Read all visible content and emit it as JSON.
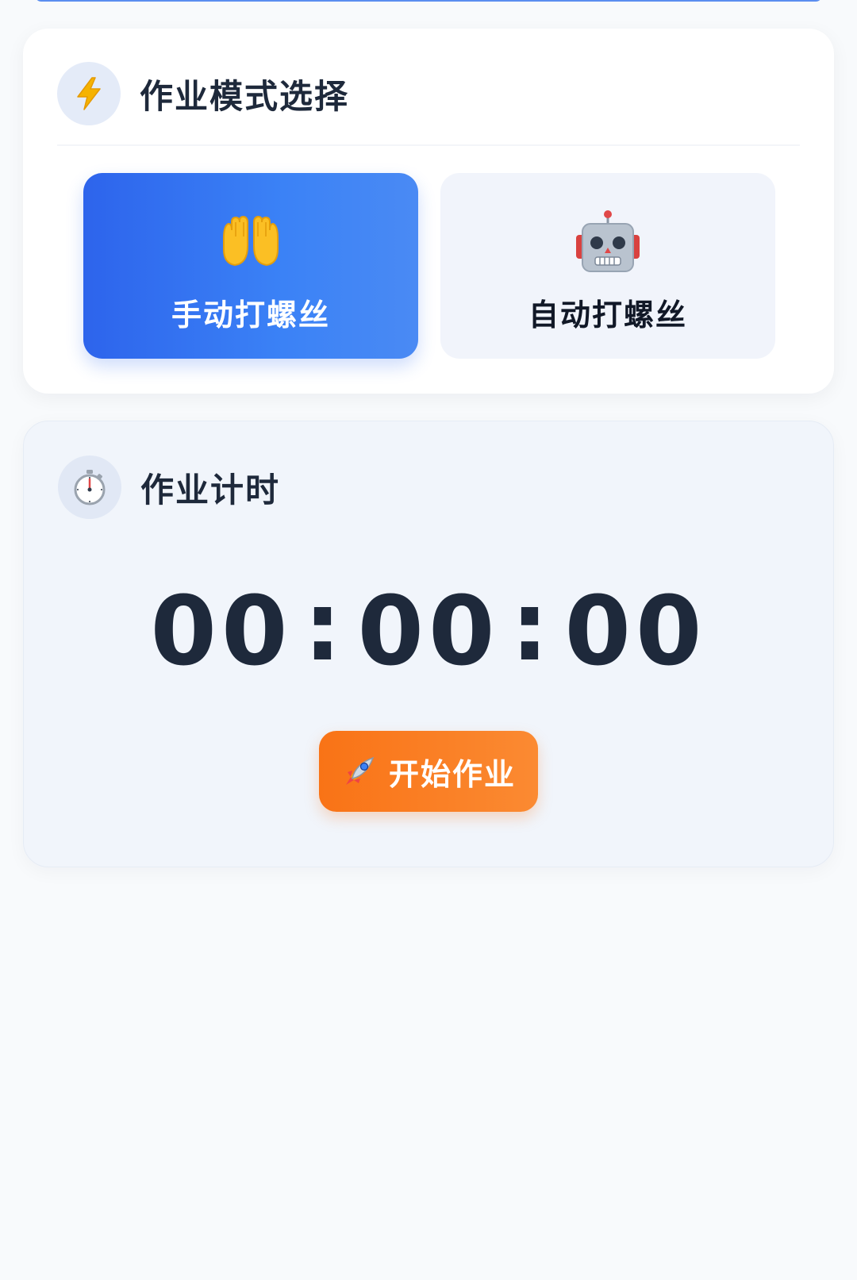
{
  "mode_section": {
    "title": "作业模式选择",
    "icon": "lightning-icon",
    "options": [
      {
        "label": "手动打螺丝",
        "icon": "open-hands-icon",
        "selected": true
      },
      {
        "label": "自动打螺丝",
        "icon": "robot-icon",
        "selected": false
      }
    ]
  },
  "timer_section": {
    "title": "作业计时",
    "icon": "stopwatch-icon",
    "hours": "00",
    "minutes": "00",
    "seconds": "00",
    "separator": ":",
    "start_button": {
      "label": "开始作业",
      "icon": "rocket-icon"
    }
  },
  "colors": {
    "selected_mode": "#3b82f6",
    "start_button": "#f97316",
    "page_background": "#f8fafc"
  }
}
